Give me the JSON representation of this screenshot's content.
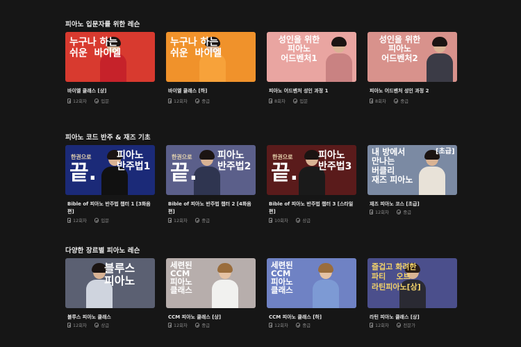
{
  "sections": [
    {
      "title": "피아노 입문자를 위한 레슨",
      "cards": [
        {
          "thumb_text": "누구나 하는\n쉬운  바이엘",
          "bg": "#d83a2f",
          "title": "바이엘 클래스 [상]",
          "count": "12회차",
          "level": "입문"
        },
        {
          "thumb_text": "누구나 하는\n쉬운  바이엘",
          "bg": "#f0922b",
          "title": "바이엘 클래스 [하]",
          "count": "12회차",
          "level": "중급"
        },
        {
          "thumb_text": "성인을 위한\n피아노\n어드벤처1",
          "bg": "#e9a5a1",
          "title": "피아노 어드벤처 성인 과정 1",
          "count": "8회차",
          "level": "입문"
        },
        {
          "thumb_text": "성인을 위한\n피아노\n어드벤처2",
          "bg": "#d8928c",
          "title": "피아노 어드벤처 성인 과정 2",
          "count": "8회차",
          "level": "중급"
        }
      ]
    },
    {
      "title": "피아노 코드 반주 & 재즈 기초",
      "cards": [
        {
          "thumb_small": "한권으로",
          "thumb_big": "끝.",
          "thumb_right": "피아노\n반주법1",
          "bg": "#1b2a78",
          "title": "Bible of 피아노 반주법 챕터 1 [3화음 편]",
          "count": "12회차",
          "level": "입문"
        },
        {
          "thumb_small": "한권으로",
          "thumb_big": "끝.",
          "thumb_right": "피아노\n반주법2",
          "bg": "#5b5f8a",
          "title": "Bible of 피아노 반주법 챕터 2 [4화음 편]",
          "count": "12회차",
          "level": "중급"
        },
        {
          "thumb_small": "한권으로",
          "thumb_big": "끝.",
          "thumb_right": "피아노\n반주법3",
          "bg": "#5a1b1b",
          "title": "Bible of 피아노 반주법 챕터 3 [스타일 편]",
          "count": "10회차",
          "level": "상급"
        },
        {
          "thumb_text": "내 방에서\n만나는\n버클리\n재즈 피아노",
          "thumb_tag": "[초급]",
          "bg": "#7b8aa3",
          "title": "재즈 피아노 코스 [초급]",
          "count": "12회차",
          "level": "중급"
        }
      ]
    },
    {
      "title": "다양한 장르별 피아노 레슨",
      "cards": [
        {
          "thumb_text": "블루스\n피아노",
          "bg": "#5b6072",
          "title": "블루스 피아노 클래스",
          "count": "12회차",
          "level": "상급"
        },
        {
          "thumb_text": "세련된\nCCM\n피아노\n클래스",
          "bg": "#b7aeac",
          "title": "CCM 피아노 클래스 [상]",
          "count": "12회차",
          "level": "중급"
        },
        {
          "thumb_text": "세련된\nCCM\n피아노\n클래스",
          "bg": "#6f82c4",
          "title": "CCM 피아노 클래스 [하]",
          "count": "12회차",
          "level": "중급"
        },
        {
          "thumb_text": "즐겁고 화려한\n파티    오브\n라틴피아노[상]",
          "bg": "#4b4f8c",
          "title": "라틴 피아노 클래스 [상]",
          "count": "12회차",
          "level": "전문가"
        }
      ]
    }
  ]
}
